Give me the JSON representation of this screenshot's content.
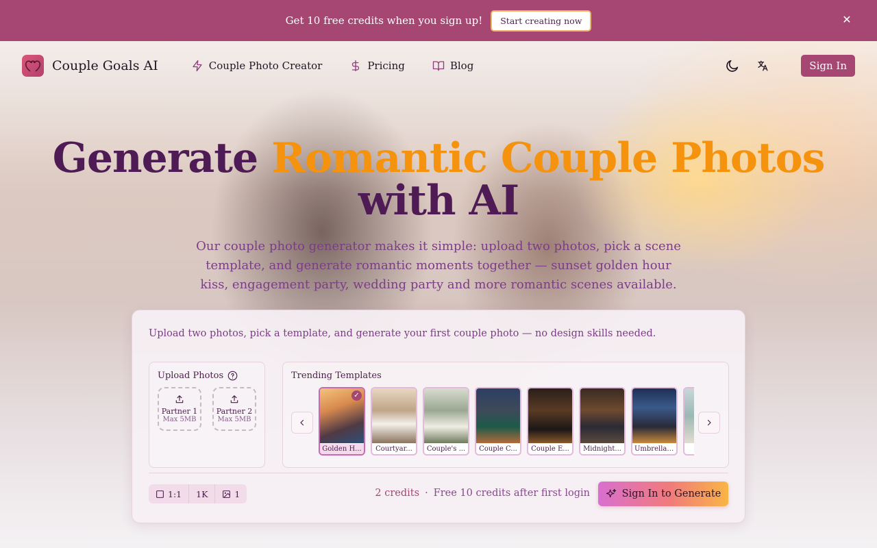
{
  "banner": {
    "text": "Get 10 free credits when you sign up!",
    "cta": "Start creating now",
    "close_glyph": "✕"
  },
  "header": {
    "brand": "Couple Goals AI",
    "nav": [
      {
        "label": "Couple Photo Creator",
        "icon": "lightning-icon"
      },
      {
        "label": "Pricing",
        "icon": "dollar-icon"
      },
      {
        "label": "Blog",
        "icon": "book-icon"
      }
    ],
    "sign_in": "Sign In"
  },
  "hero": {
    "title_part1": "Generate ",
    "title_accent": "Romantic Couple Photos",
    "title_part2": " with AI",
    "subtitle": "Our couple photo generator makes it simple: upload two photos, pick a scene template, and generate romantic moments together — sunset golden hour kiss, engagement party, wedding party and more romantic scenes available."
  },
  "card": {
    "intro": "Upload two photos, pick a template, and generate your first couple photo — no design skills needed.",
    "upload": {
      "title": "Upload Photos",
      "partner1": "Partner 1",
      "partner2": "Partner 2",
      "max_size": "Max 5MB"
    },
    "templates": {
      "title": "Trending Templates",
      "items": [
        {
          "label": "Golden H...",
          "selected": true
        },
        {
          "label": "Courtyar...",
          "selected": false
        },
        {
          "label": "Couple's ...",
          "selected": false
        },
        {
          "label": "Couple C...",
          "selected": false
        },
        {
          "label": "Couple E...",
          "selected": false
        },
        {
          "label": "Midnight...",
          "selected": false
        },
        {
          "label": "Umbrella ...",
          "selected": false
        },
        {
          "label": "Sh",
          "selected": false
        }
      ]
    },
    "options": {
      "ratio": "1:1",
      "resolution": "1K",
      "count": "1"
    },
    "credits": "2 credits",
    "separator": "·",
    "free_note": "Free 10 credits after first login",
    "generate": "Sign In to Generate"
  },
  "colors": {
    "brand": "#a54673",
    "accent": "#f5930e",
    "title": "#4e1b55"
  }
}
